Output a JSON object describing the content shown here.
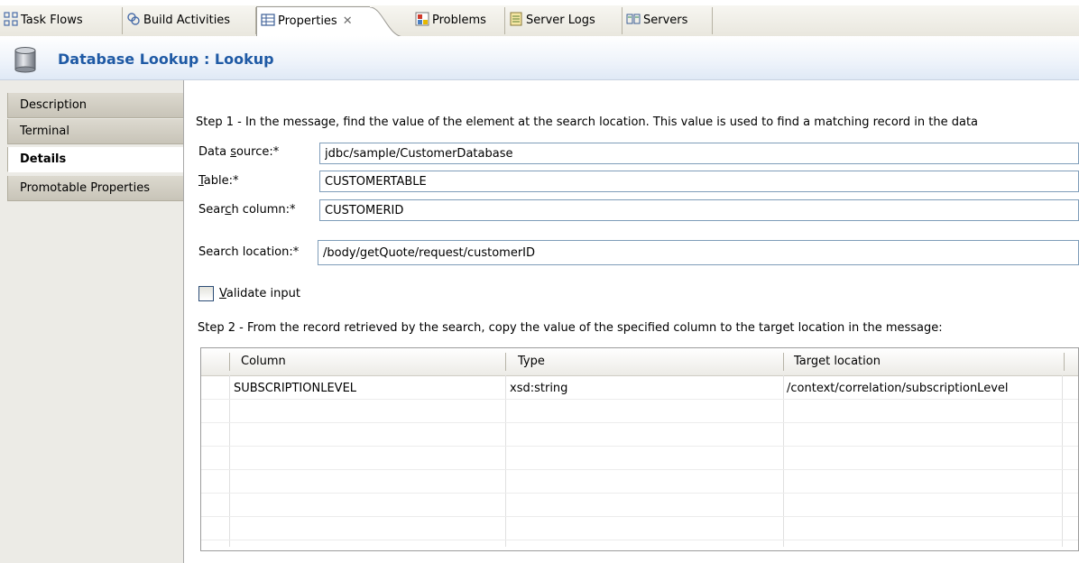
{
  "tabs": [
    {
      "label": "Task Flows",
      "icon": "task-flows-icon"
    },
    {
      "label": "Build Activities",
      "icon": "build-activities-icon"
    },
    {
      "label": "Properties",
      "icon": "properties-icon",
      "active": true,
      "close": "✕"
    },
    {
      "label": "Problems",
      "icon": "problems-icon"
    },
    {
      "label": "Server Logs",
      "icon": "server-logs-icon"
    },
    {
      "label": "Servers",
      "icon": "servers-icon"
    }
  ],
  "title": "Database Lookup : Lookup",
  "sidebar": {
    "items": [
      "Description",
      "Terminal",
      "Details",
      "Promotable Properties"
    ],
    "active_index": 2
  },
  "form": {
    "step1": "Step 1 - In the message, find the value of the element at the search location. This value is used to find a matching record in the data",
    "data_source_label_pre": "Data ",
    "data_source_label_u": "s",
    "data_source_label_post": "ource:*",
    "data_source_value": "jdbc/sample/CustomerDatabase",
    "table_label_u": "T",
    "table_label_post": "able:*",
    "table_value": "CUSTOMERTABLE",
    "search_column_label_pre": "Sear",
    "search_column_label_u": "c",
    "search_column_label_post": "h column:*",
    "search_column_value": "CUSTOMERID",
    "search_location_label": "Search location:*",
    "search_location_value": "/body/getQuote/request/customerID",
    "validate_u": "V",
    "validate_post": "alidate input",
    "validate_checked": false,
    "step2": "Step 2 - From the record retrieved by the search, copy the value of the specified column to the target location in the message:"
  },
  "table": {
    "columns": [
      "Column",
      "Type",
      "Target location"
    ],
    "rows": [
      [
        "SUBSCRIPTIONLEVEL",
        "xsd:string",
        "/context/correlation/subscriptionLevel"
      ]
    ]
  },
  "colors": {
    "title": "#1f5aa5",
    "input_border": "#7f9db9"
  }
}
